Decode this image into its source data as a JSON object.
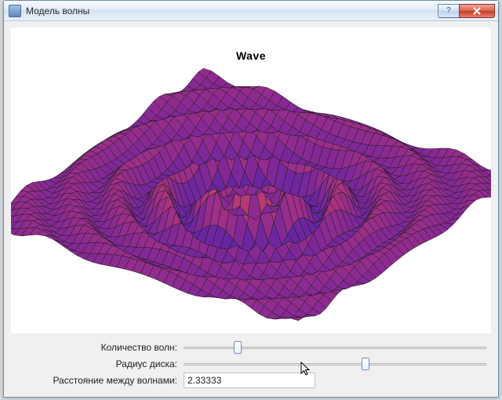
{
  "window": {
    "title": "Модель волны"
  },
  "chart_data": {
    "type": "surface3d",
    "title": "Wave",
    "function": "radial_wave",
    "grid": {
      "nx": 40,
      "ny": 40,
      "extent": [
        -10,
        10,
        -10,
        10
      ]
    },
    "params": {
      "wave_count": 3,
      "disc_radius": 6.0,
      "wave_spacing": 2.33333
    },
    "view": {
      "azimuth_deg": -55,
      "elevation_deg": 28
    },
    "colormap": "plasma",
    "wireframe": true,
    "zlim": [
      -1.2,
      1.6
    ]
  },
  "controls": {
    "wave_count": {
      "label": "Количество волн:",
      "value": 3,
      "min": 1,
      "max": 12,
      "pct": 18
    },
    "disc_radius": {
      "label": "Радиус диска:",
      "value": 6.0,
      "min": 0.5,
      "max": 10,
      "pct": 60
    },
    "wave_spacing": {
      "label": "Расстояние между волнами:",
      "value_text": "2.33333"
    }
  },
  "titlebar_buttons": {
    "help_tooltip": "?",
    "close_tooltip": "X"
  },
  "colors": {
    "surface_low": "#3b2fd1",
    "surface_mid": "#7d2a8c",
    "surface_high": "#e06a2e",
    "wire": "#1a1a1a"
  }
}
